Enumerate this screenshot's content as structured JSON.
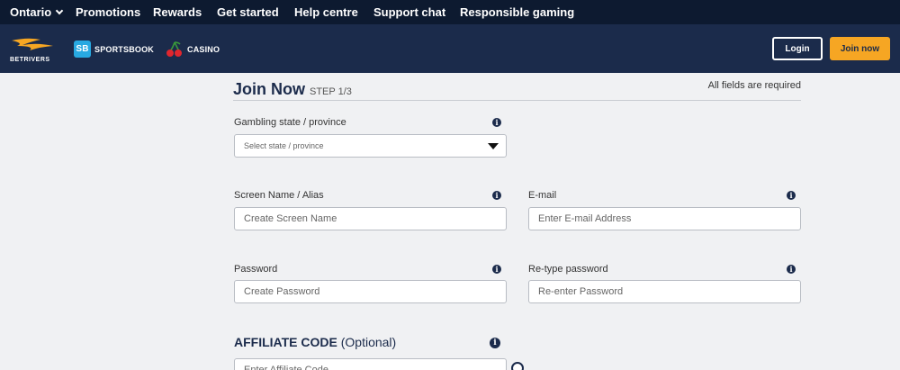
{
  "topbar": {
    "region": "Ontario",
    "nav": [
      "Promotions",
      "Rewards",
      "Get started",
      "Help centre",
      "Support chat",
      "Responsible gaming"
    ]
  },
  "header": {
    "logo_text": "BETRIVERS",
    "sportsbook_label": "SPORTSBOOK",
    "sportsbook_badge": "SB",
    "casino_label": "CASINO",
    "login_label": "Login",
    "join_label": "Join now"
  },
  "form": {
    "title": "Join Now",
    "step": "STEP 1/3",
    "required_note": "All fields are required",
    "state": {
      "label": "Gambling state / province",
      "placeholder": "Select state / province"
    },
    "screen_name": {
      "label": "Screen Name / Alias",
      "placeholder": "Create Screen Name"
    },
    "email": {
      "label": "E-mail",
      "placeholder": "Enter E-mail Address"
    },
    "password": {
      "label": "Password",
      "placeholder": "Create Password"
    },
    "retype": {
      "label": "Re-type password",
      "placeholder": "Re-enter Password"
    },
    "affiliate": {
      "title_bold": "AFFILIATE CODE",
      "title_rest": "(Optional)",
      "placeholder": "Enter Affiliate Code"
    },
    "info_glyph": "i"
  },
  "colors": {
    "topbar": "#0d1a30",
    "header": "#1b2b4b",
    "accent": "#f6a623",
    "page": "#f0f1f3"
  }
}
